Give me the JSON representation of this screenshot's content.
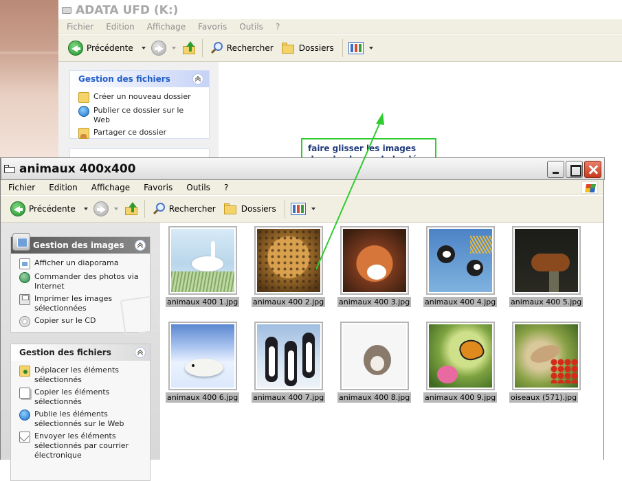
{
  "back_window": {
    "title": "ADATA UFD (K:)",
    "menu": [
      "Fichier",
      "Edition",
      "Affichage",
      "Favoris",
      "Outils",
      "?"
    ],
    "toolbar": {
      "back": "Précédente",
      "search": "Rechercher",
      "folders": "Dossiers"
    },
    "task_pane": {
      "title": "Gestion des fichiers",
      "items": [
        "Créer un nouveau dossier",
        "Publier ce dossier sur le Web",
        "Partager ce dossier"
      ]
    },
    "callout": "faire glisser les images dans le champ de la clé usb"
  },
  "front_window": {
    "title": "animaux 400x400",
    "menu": [
      "Fichier",
      "Edition",
      "Affichage",
      "Favoris",
      "Outils",
      "?"
    ],
    "toolbar": {
      "back": "Précédente",
      "search": "Rechercher",
      "folders": "Dossiers"
    },
    "images_pane": {
      "title": "Gestion des images",
      "items": [
        "Afficher un diaporama",
        "Commander des photos via Internet",
        "Imprimer les images sélectionnées",
        "Copier sur le CD"
      ]
    },
    "files_pane": {
      "title": "Gestion des fichiers",
      "items": [
        "Déplacer les éléments sélectionnés",
        "Copier les éléments sélectionnés",
        "Publie les éléments sélectionnés sur le Web",
        "Envoyer les éléments sélectionnés par courrier électronique"
      ]
    },
    "thumbnails": [
      {
        "name": "animaux 400 1.jpg",
        "subject": "swan"
      },
      {
        "name": "animaux 400 2.jpg",
        "subject": "leopard"
      },
      {
        "name": "animaux 400 3.jpg",
        "subject": "fox"
      },
      {
        "name": "animaux 400 4.jpg",
        "subject": "crowned cranes"
      },
      {
        "name": "animaux 400 5.jpg",
        "subject": "marten"
      },
      {
        "name": "animaux 400 6.jpg",
        "subject": "seal pup"
      },
      {
        "name": "animaux 400 7.jpg",
        "subject": "penguins"
      },
      {
        "name": "animaux 400 8.jpg",
        "subject": "squirrel"
      },
      {
        "name": "animaux 400 9.jpg",
        "subject": "butterfly"
      },
      {
        "name": "oiseaux (571).jpg",
        "subject": "waxwing bird"
      }
    ]
  },
  "colors": {
    "callout_border": "#2fcc2f",
    "arrow": "#2fcc2f",
    "link_blue": "#215dc6"
  }
}
